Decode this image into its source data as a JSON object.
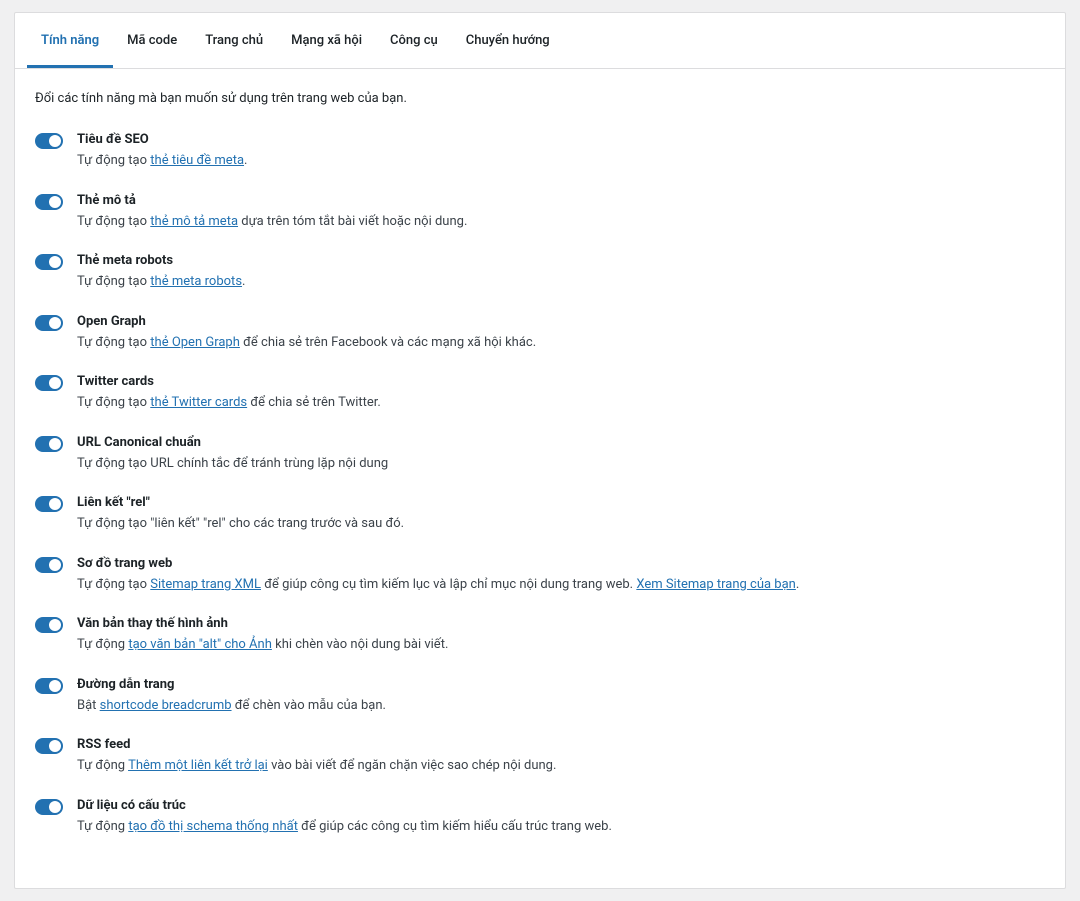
{
  "tabs": [
    {
      "label": "Tính năng",
      "active": true
    },
    {
      "label": "Mã code",
      "active": false
    },
    {
      "label": "Trang chủ",
      "active": false
    },
    {
      "label": "Mạng xã hội",
      "active": false
    },
    {
      "label": "Công cụ",
      "active": false
    },
    {
      "label": "Chuyển hướng",
      "active": false
    }
  ],
  "intro": "Đổi các tính năng mà bạn muốn sử dụng trên trang web của bạn.",
  "features": [
    {
      "title": "Tiêu đề SEO",
      "on": true,
      "desc": [
        {
          "t": "Tự động tạo "
        },
        {
          "t": "thẻ tiêu đề meta",
          "link": true
        },
        {
          "t": "."
        }
      ]
    },
    {
      "title": "Thẻ mô tả",
      "on": true,
      "desc": [
        {
          "t": "Tự động tạo "
        },
        {
          "t": "thẻ mô tả meta",
          "link": true
        },
        {
          "t": " dựa trên tóm tắt bài viết hoặc nội dung."
        }
      ]
    },
    {
      "title": "Thẻ meta robots",
      "on": true,
      "desc": [
        {
          "t": "Tự động tạo "
        },
        {
          "t": "thẻ meta robots",
          "link": true
        },
        {
          "t": "."
        }
      ]
    },
    {
      "title": "Open Graph",
      "on": true,
      "desc": [
        {
          "t": "Tự động tạo "
        },
        {
          "t": "thẻ Open Graph",
          "link": true
        },
        {
          "t": " để chia sẻ trên Facebook và các mạng xã hội khác."
        }
      ]
    },
    {
      "title": "Twitter cards",
      "on": true,
      "desc": [
        {
          "t": "Tự động tạo "
        },
        {
          "t": "thẻ Twitter cards",
          "link": true
        },
        {
          "t": " để chia sẻ trên Twitter."
        }
      ]
    },
    {
      "title": "URL Canonical chuẩn",
      "on": true,
      "desc": [
        {
          "t": "Tự động tạo URL chính tắc để tránh trùng lặp nội dung"
        }
      ]
    },
    {
      "title": "Liên kết \"rel\"",
      "on": true,
      "desc": [
        {
          "t": "Tự động tạo \"liên kết\" \"rel\" cho các trang trước và sau đó."
        }
      ]
    },
    {
      "title": "Sơ đồ trang web",
      "on": true,
      "desc": [
        {
          "t": "Tự động tạo "
        },
        {
          "t": "Sitemap trang XML",
          "link": true
        },
        {
          "t": " để giúp công cụ tìm kiếm lục và lập chỉ mục nội dung trang web. "
        },
        {
          "t": "Xem Sitemap trang của bạn",
          "link": true
        },
        {
          "t": "."
        }
      ]
    },
    {
      "title": "Văn bản thay thế hình ảnh",
      "on": true,
      "desc": [
        {
          "t": "Tự động "
        },
        {
          "t": "tạo văn bản \"alt\" cho Ảnh",
          "link": true
        },
        {
          "t": " khi chèn vào nội dung bài viết."
        }
      ]
    },
    {
      "title": "Đường dẫn trang",
      "on": true,
      "desc": [
        {
          "t": "Bật "
        },
        {
          "t": "shortcode breadcrumb",
          "link": true
        },
        {
          "t": " để chèn vào mẫu của bạn."
        }
      ]
    },
    {
      "title": "RSS feed",
      "on": true,
      "desc": [
        {
          "t": "Tự động "
        },
        {
          "t": "Thêm một liên kết trở lại",
          "link": true
        },
        {
          "t": " vào bài viết để ngăn chặn việc sao chép nội dung."
        }
      ]
    },
    {
      "title": "Dữ liệu có cấu trúc",
      "on": true,
      "desc": [
        {
          "t": "Tự động "
        },
        {
          "t": "tạo đồ thị schema thống nhất",
          "link": true
        },
        {
          "t": " để giúp các công cụ tìm kiếm hiểu cấu trúc trang web."
        }
      ]
    }
  ]
}
